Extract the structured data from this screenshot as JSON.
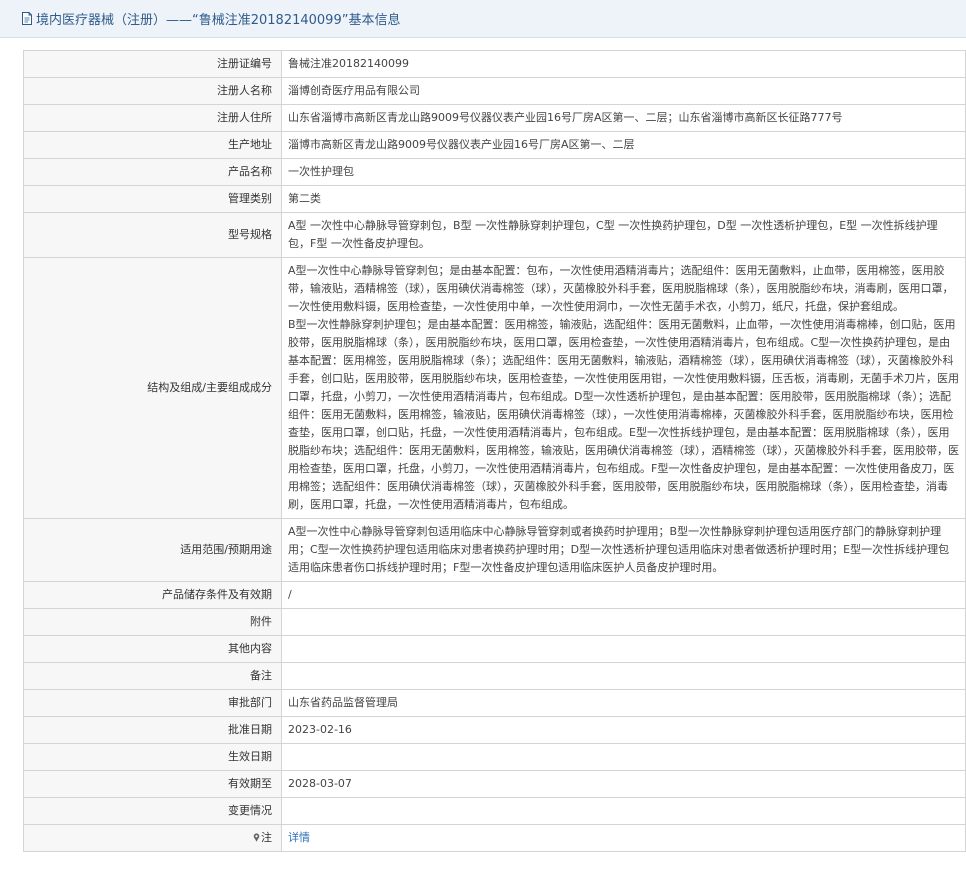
{
  "header": {
    "title": "境内医疗器械（注册）——“鲁械注准20182140099”基本信息"
  },
  "rows": [
    {
      "label": "注册证编号",
      "value": "鲁械注准20182140099"
    },
    {
      "label": "注册人名称",
      "value": "淄博创奇医疗用品有限公司"
    },
    {
      "label": "注册人住所",
      "value": "山东省淄博市高新区青龙山路9009号仪器仪表产业园16号厂房A区第一、二层；山东省淄博市高新区长征路777号"
    },
    {
      "label": "生产地址",
      "value": "淄博市高新区青龙山路9009号仪器仪表产业园16号厂房A区第一、二层"
    },
    {
      "label": "产品名称",
      "value": "一次性护理包"
    },
    {
      "label": "管理类别",
      "value": "第二类"
    },
    {
      "label": "型号规格",
      "value": "A型 一次性中心静脉导管穿刺包，B型 一次性静脉穿刺护理包，C型 一次性换药护理包，D型 一次性透析护理包，E型 一次性拆线护理包，F型 一次性备皮护理包。"
    },
    {
      "label": "结构及组成/主要组成成分",
      "value_lines": [
        " A型一次性中心静脉导管穿刺包；是由基本配置：包布，一次性使用酒精消毒片；选配组件：医用无菌敷料，止血带，医用棉签，医用胶带，输液贴，酒精棉签（球），医用碘伏消毒棉签（球），灭菌橡胶外科手套，医用脱脂棉球（条），医用脱脂纱布块，消毒刷，医用口罩，一次性使用敷料镊，医用检查垫，一次性使用中单，一次性使用洞巾，一次性无菌手术衣，小剪刀，纸尺，托盘，保护套组成。",
        " B型一次性静脉穿刺护理包；是由基本配置：医用棉签，输液贴，选配组件：医用无菌敷料，止血带，一次性使用消毒棉棒，创口贴，医用胶带，医用脱脂棉球（条），医用脱脂纱布块，医用口罩，医用检查垫，一次性使用酒精消毒片，包布组成。C型一次性换药护理包，是由基本配置：医用棉签，医用脱脂棉球（条）；选配组件：医用无菌敷料，输液贴，酒精棉签（球），医用碘伏消毒棉签（球），灭菌橡胶外科手套，创口贴，医用胶带，医用脱脂纱布块，医用检查垫，一次性使用医用钳，一次性使用敷料镊，压舌板，消毒刷，无菌手术刀片，医用口罩，托盘，小剪刀，一次性使用酒精消毒片，包布组成。D型一次性透析护理包，是由基本配置：医用胶带，医用脱脂棉球（条）；选配组件：医用无菌敷料，医用棉签，输液贴，医用碘伏消毒棉签（球），一次性使用消毒棉棒，灭菌橡胶外科手套，医用脱脂纱布块，医用检查垫，医用口罩，创口贴，托盘，一次性使用酒精消毒片，包布组成。E型一次性拆线护理包，是由基本配置：医用脱脂棉球（条），医用脱脂纱布块；选配组件：医用无菌敷料，医用棉签，输液贴，医用碘伏消毒棉签（球），酒精棉签（球），灭菌橡胶外科手套，医用胶带，医用检查垫，医用口罩，托盘，小剪刀，一次性使用酒精消毒片，包布组成。F型一次性备皮护理包，是由基本配置：一次性使用备皮刀，医用棉签；选配组件：医用碘伏消毒棉签（球），灭菌橡胶外科手套，医用胶带，医用脱脂纱布块，医用脱脂棉球（条），医用检查垫，消毒刷，医用口罩，托盘，一次性使用酒精消毒片，包布组成。"
      ]
    },
    {
      "label": "适用范围/预期用途",
      "value": "A型一次性中心静脉导管穿刺包适用临床中心静脉导管穿刺或者换药时护理用；B型一次性静脉穿刺护理包适用医疗部门的静脉穿刺护理用；C型一次性换药护理包适用临床对患者换药护理时用；D型一次性透析护理包适用临床对患者做透析护理时用；E型一次性拆线护理包适用临床患者伤口拆线护理时用；F型一次性备皮护理包适用临床医护人员备皮护理时用。"
    },
    {
      "label": "产品储存条件及有效期",
      "value": "/"
    },
    {
      "label": "附件",
      "value": ""
    },
    {
      "label": "其他内容",
      "value": ""
    },
    {
      "label": "备注",
      "value": ""
    },
    {
      "label": "审批部门",
      "value": "山东省药品监督管理局"
    },
    {
      "label": "批准日期",
      "value": "2023-02-16"
    },
    {
      "label": "生效日期",
      "value": ""
    },
    {
      "label": "有效期至",
      "value": "2028-03-07"
    },
    {
      "label": "变更情况",
      "value": ""
    },
    {
      "label": "注",
      "value": "详情",
      "icon": "pin-icon"
    }
  ]
}
